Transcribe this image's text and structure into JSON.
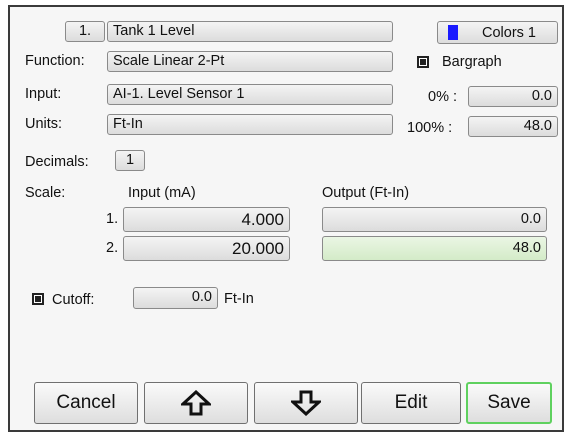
{
  "header": {
    "channel_number": "1.",
    "channel_name": "Tank 1 Level",
    "colors_label": "Colors 1",
    "colors_swatch": "#1a1aff"
  },
  "function": {
    "label": "Function:",
    "value": "Scale Linear 2-Pt"
  },
  "bargraph": {
    "label": "Bargraph",
    "checked": true
  },
  "input": {
    "label": "Input:",
    "value": "AI-1. Level Sensor 1"
  },
  "units": {
    "label": "Units:",
    "value": "Ft-In"
  },
  "bar_range": {
    "zero_label": "0% :",
    "zero_value": "0.0",
    "full_label": "100% :",
    "full_value": "48.0"
  },
  "decimals": {
    "label": "Decimals:",
    "value": "1"
  },
  "scale": {
    "label": "Scale:",
    "input_header": "Input (mA)",
    "output_header": "Output (Ft-In)",
    "rows": [
      {
        "index": "1.",
        "input": "4.000",
        "output": "0.0"
      },
      {
        "index": "2.",
        "input": "20.000",
        "output": "48.0"
      }
    ]
  },
  "cutoff": {
    "label": "Cutoff:",
    "value": "0.0",
    "unit": "Ft-In",
    "checked": true
  },
  "buttons": {
    "cancel": "Cancel",
    "up_icon": "arrow-up-icon",
    "down_icon": "arrow-down-icon",
    "edit": "Edit",
    "save": "Save"
  }
}
